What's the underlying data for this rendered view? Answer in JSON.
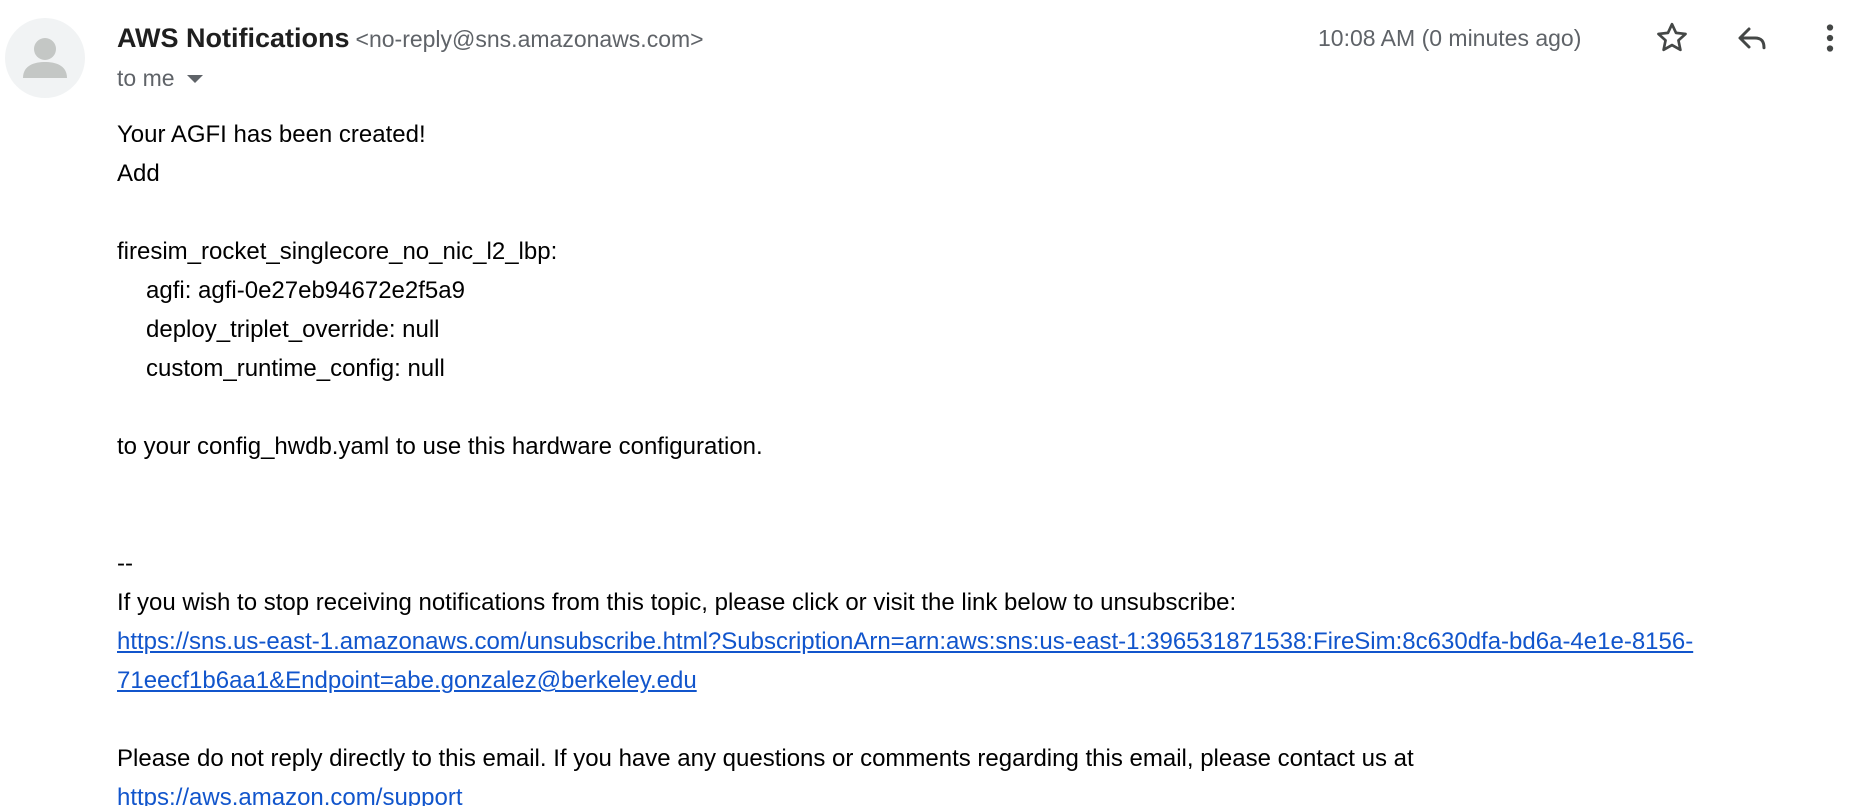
{
  "header": {
    "sender_name": "AWS Notifications",
    "sender_email": "<no-reply@sns.amazonaws.com>",
    "recipient": "to me",
    "timestamp": "10:08 AM (0 minutes ago)",
    "icons": [
      "avatar-icon",
      "star-icon",
      "reply-icon",
      "more-vert-icon",
      "chevron-down-icon"
    ]
  },
  "body": {
    "line1": "Your AGFI has been created!",
    "line2": "Add",
    "config_name": "firesim_rocket_singlecore_no_nic_l2_lbp:",
    "config_agfi": "agfi: agfi-0e27eb94672e2f5a9",
    "config_deploy": "deploy_triplet_override: null",
    "config_runtime": "custom_runtime_config: null",
    "instruction": "to your config_hwdb.yaml to use this hardware configuration.",
    "signature_sep": "--",
    "unsubscribe_text": "If you wish to stop receiving notifications from this topic, please click or visit the link below to unsubscribe:",
    "unsubscribe_link_line1": "https://sns.us-east-1.amazonaws.com/unsubscribe.html?SubscriptionArn=arn:aws:sns:us-east-1:396531871538:FireSim:8c630dfa-bd6a-4e1e-8156-",
    "unsubscribe_link_line2": "71eecf1b6aa1&Endpoint=abe.gonzalez@berkeley.edu",
    "noreply_text": "Please do not reply directly to this email. If you have any questions or comments regarding this email, please contact us at",
    "support_link": "https://aws.amazon.com/support"
  },
  "colors": {
    "link": "#1155cc",
    "meta_text": "#5f6368",
    "avatar_bg": "#f1f3f4",
    "avatar_fg": "#c4c7c5"
  }
}
